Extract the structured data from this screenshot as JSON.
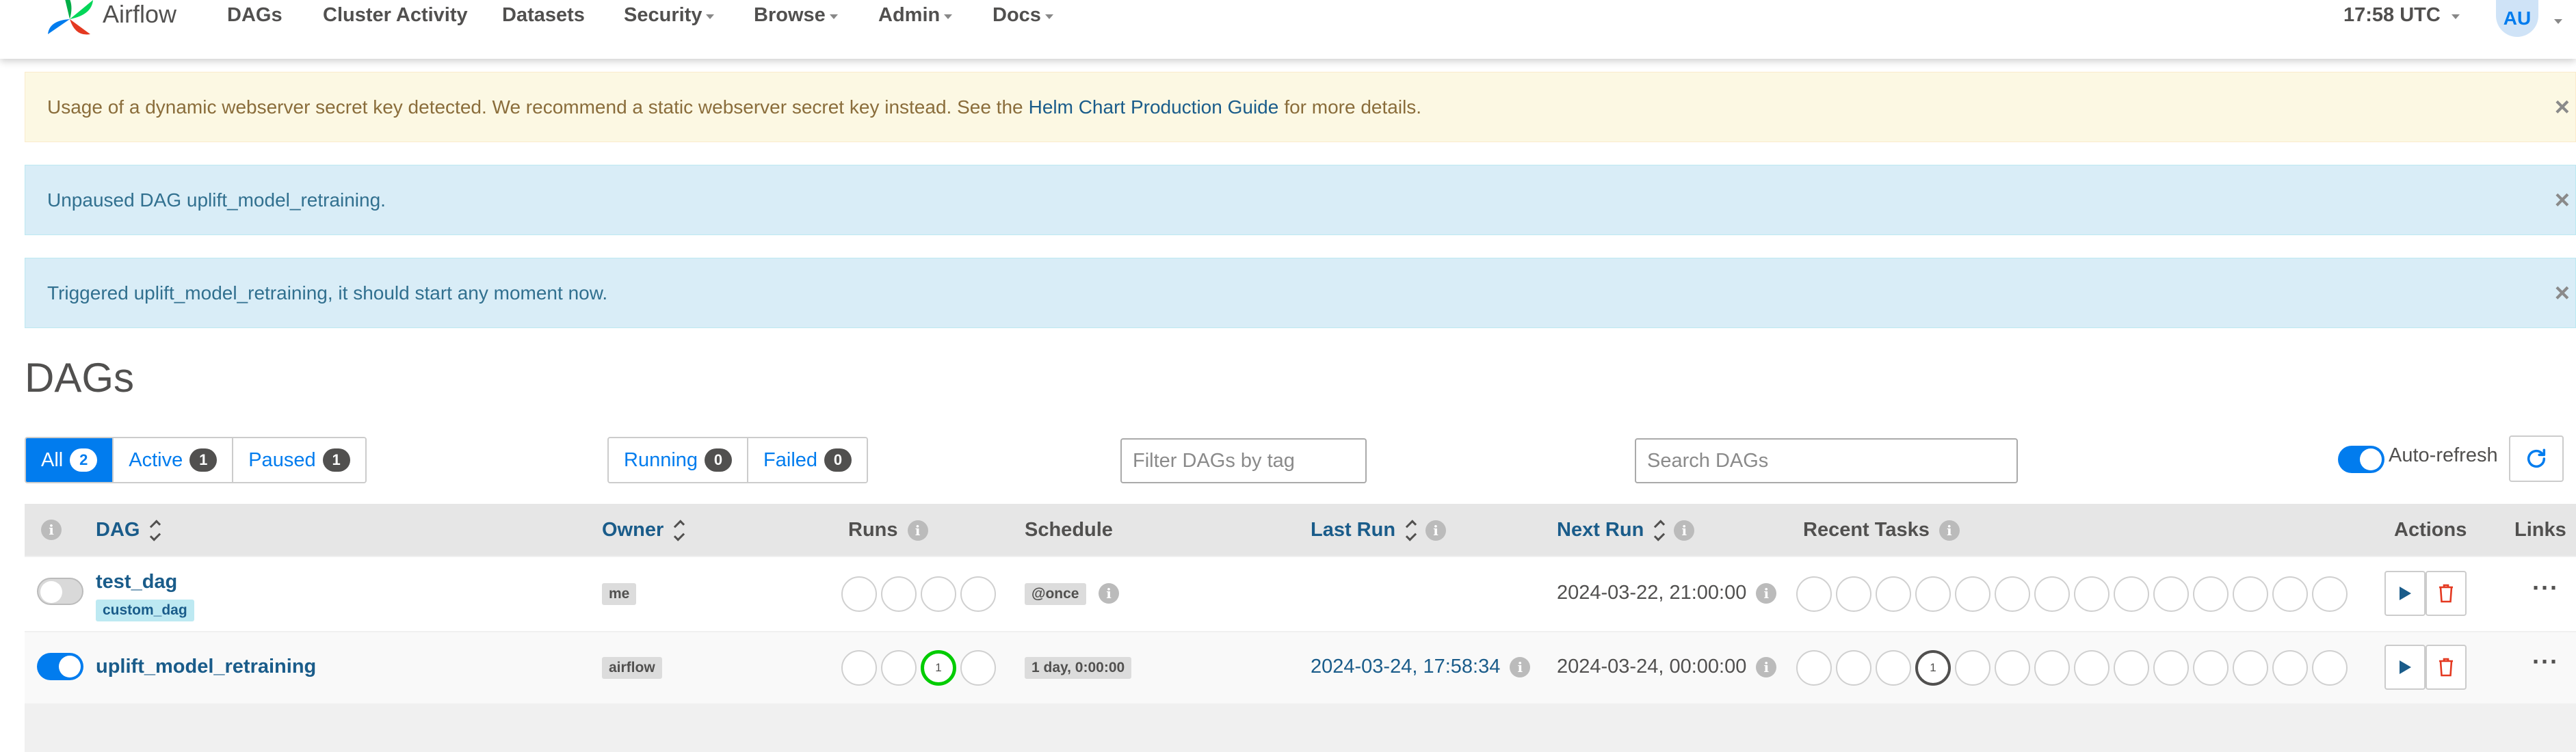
{
  "navbar": {
    "brand": "Airflow",
    "items": [
      {
        "label": "DAGs"
      },
      {
        "label": "Cluster Activity"
      },
      {
        "label": "Datasets"
      },
      {
        "label": "Security"
      },
      {
        "label": "Browse"
      },
      {
        "label": "Admin"
      },
      {
        "label": "Docs"
      }
    ],
    "time": "17:58 UTC",
    "user_initials": "AU"
  },
  "alerts": {
    "secret_key": {
      "text_before": "Usage of a dynamic webserver secret key detected. We recommend a static webserver secret key instead. See the",
      "link": "Helm Chart Production Guide",
      "text_after": "for more details."
    },
    "unpaused": "Unpaused DAG uplift_model_retraining.",
    "triggered": "Triggered uplift_model_retraining, it should start any moment now.",
    "close": "×"
  },
  "page_title": "DAGs",
  "filters": {
    "all": {
      "label": "All",
      "count": "2"
    },
    "active": {
      "label": "Active",
      "count": "1"
    },
    "paused": {
      "label": "Paused",
      "count": "1"
    },
    "running": {
      "label": "Running",
      "count": "0"
    },
    "failed": {
      "label": "Failed",
      "count": "0"
    },
    "tag_placeholder": "Filter DAGs by tag",
    "search_placeholder": "Search DAGs",
    "auto_refresh": "Auto-refresh"
  },
  "table": {
    "headers": {
      "dag": "DAG",
      "owner": "Owner",
      "runs": "Runs",
      "schedule": "Schedule",
      "last_run": "Last Run",
      "next_run": "Next Run",
      "recent_tasks": "Recent Tasks",
      "actions": "Actions",
      "links": "Links"
    },
    "info_glyph": "i",
    "more_glyph": "···",
    "rows": [
      {
        "paused": true,
        "dag_id": "test_dag",
        "tag": "custom_dag",
        "owner": "me",
        "runs": [
          "",
          "",
          "",
          ""
        ],
        "schedule": "@once",
        "last_run": "",
        "next_run": "2024-03-22, 21:00:00",
        "recent_tasks": [
          "",
          "",
          "",
          "",
          "",
          "",
          "",
          "",
          "",
          "",
          "",
          "",
          "",
          ""
        ]
      },
      {
        "paused": false,
        "dag_id": "uplift_model_retraining",
        "owner": "airflow",
        "runs": [
          "",
          "",
          "1",
          ""
        ],
        "schedule": "1 day, 0:00:00",
        "last_run": "2024-03-24, 17:58:34",
        "next_run": "2024-03-24, 00:00:00",
        "recent_tasks": [
          "",
          "",
          "",
          "1",
          "",
          "",
          "",
          "",
          "",
          "",
          "",
          "",
          "",
          ""
        ]
      }
    ]
  },
  "colors": {
    "primary": "#017cee",
    "link": "#1a5c8a",
    "success": "#00cc00",
    "warning_bg": "#fcf8e3",
    "info_bg": "#d9edf7",
    "delete": "#e43921"
  }
}
